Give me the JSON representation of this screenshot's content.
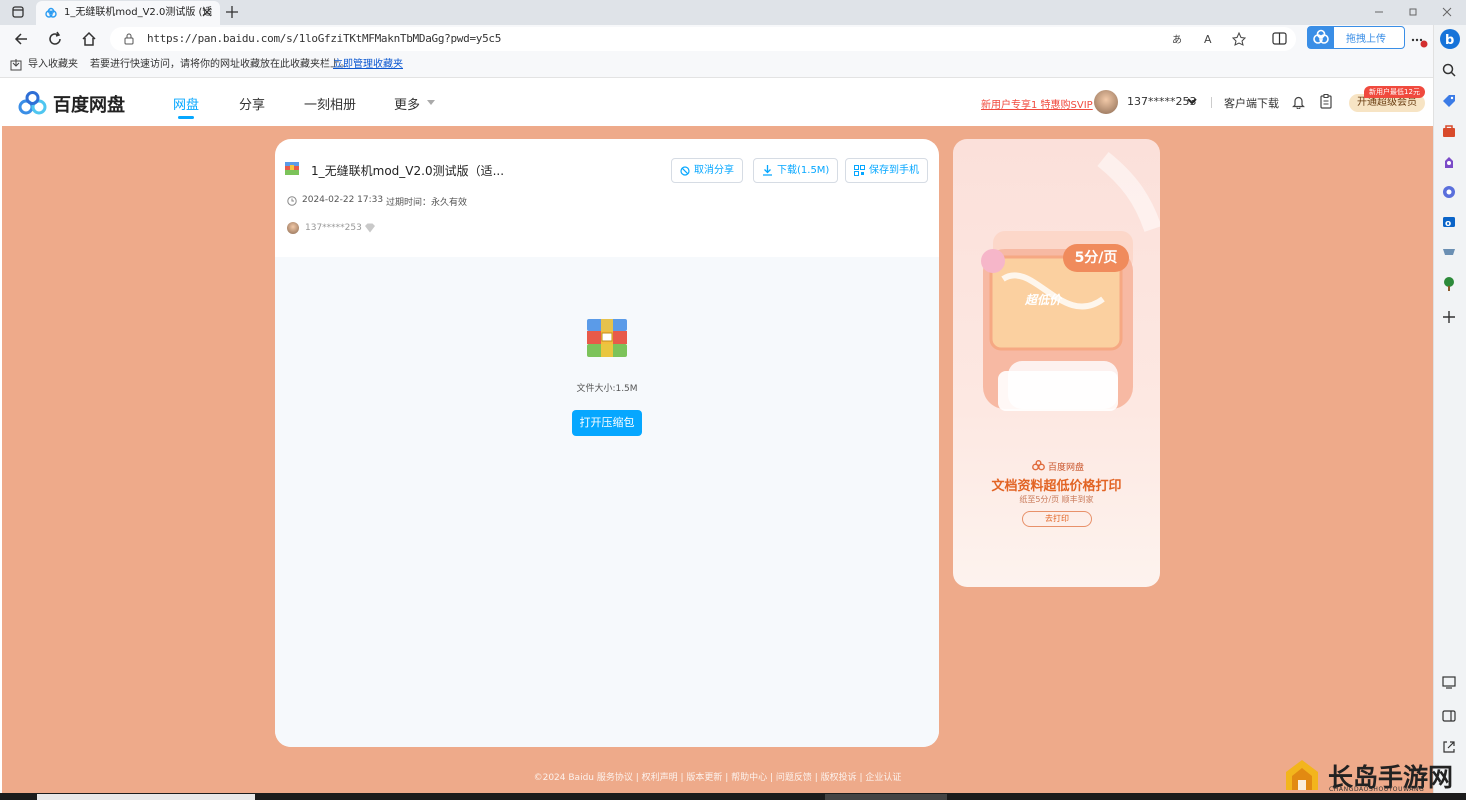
{
  "browser": {
    "tab_title": "1_无缝联机mod_V2.0测试版 (适",
    "url": "https://pan.baidu.com/s/1loGfziTKtMFMaknTbMDaGg?pwd=y5c5",
    "upload_button": "拖拽上传",
    "favorites_bar": {
      "import_label": "导入收藏夹",
      "hint": "若要进行快速访问，请将你的网址收藏放在此收藏夹栏上。",
      "manage_link": "立即管理收藏夹"
    }
  },
  "site": {
    "logo_text": "百度网盘",
    "nav": [
      {
        "label": "网盘",
        "active": true
      },
      {
        "label": "分享",
        "active": false
      },
      {
        "label": "一刻相册",
        "active": false
      },
      {
        "label": "更多",
        "active": false
      }
    ],
    "promo": "新用户专享1 特惠购SVIP",
    "username": "137*****253",
    "client_download": "客户端下载",
    "vip_button": "开通超级会员",
    "vip_badge": "新用户最低12元"
  },
  "share": {
    "file_title": "1_无缝联机mod_V2.0测试版（适...",
    "cancel_share": "取消分享",
    "download": "下载(1.5M)",
    "save_to_phone": "保存到手机",
    "date": "2024-02-22 17:33",
    "expiry_label": "过期时间：永久有效",
    "owner": "137*****253",
    "file_size": "文件大小:1.5M",
    "open_button": "打开压缩包"
  },
  "ad": {
    "price": "5分/页",
    "stamp": "超低价",
    "brand": "百度网盘",
    "headline": "文档资料超低价格打印",
    "subline": "纸至5分/页 顺丰到家",
    "cta": "去打印"
  },
  "footer": "©2024 Baidu  服务协议 | 权利声明 | 版本更新 | 帮助中心 | 问题反馈 | 版权投诉 | 企业认证",
  "watermark": {
    "cn": "长岛手游网",
    "en": "CHANGDAOSHOUYOUWANG"
  },
  "colors": {
    "accent": "#06a7ff",
    "background": "#eeaa8a",
    "promo_red": "#f04a3e"
  }
}
